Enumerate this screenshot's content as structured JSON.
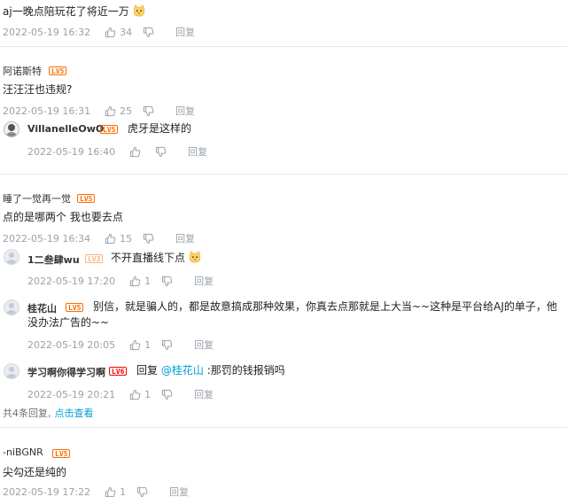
{
  "comments": [
    {
      "text": "aj一晚点陪玩花了将近一万",
      "time": "2022-05-19 16:32",
      "likes": "34",
      "reply_label": "回复"
    },
    {
      "user": "阿诺斯特",
      "level": "LV5",
      "text": "汪汪汪也违规?",
      "time": "2022-05-19 16:31",
      "likes": "25",
      "reply_label": "回复",
      "replies": [
        {
          "user": "VillanelleOwO",
          "level": "LV5",
          "text": "虎牙是这样的",
          "time": "2022-05-19 16:40",
          "reply_label": "回复"
        }
      ]
    },
    {
      "user": "睡了一觉再一觉",
      "level": "LV5",
      "text": "点的是哪两个 我也要去点",
      "time": "2022-05-19 16:34",
      "likes": "15",
      "reply_label": "回复",
      "replies": [
        {
          "user": "1二叁肆wu",
          "level": "LV3",
          "text": "不开直播线下点",
          "time": "2022-05-19 17:20",
          "likes": "1",
          "reply_label": "回复"
        },
        {
          "user": "桂花山",
          "level": "LV5",
          "text": "别信，就是骗人的，都是故意搞成那种效果，你真去点那就是上大当~~这种是平台给AJ的单子，他没办法广告的~~",
          "time": "2022-05-19 20:05",
          "likes": "1",
          "reply_label": "回复"
        },
        {
          "user": "学习啊你得学习啊",
          "level": "LV6",
          "reply_prefix": "回复",
          "mention": "@桂花山",
          "text": ":那罚的钱报销吗",
          "time": "2022-05-19 20:21",
          "likes": "1",
          "reply_label": "回复"
        }
      ],
      "summary_text": "共4条回复,",
      "summary_link": "点击查看"
    },
    {
      "user": "-niBGNR",
      "level": "LV5",
      "text": "尖勾还是纯的",
      "time": "2022-05-19 17:22",
      "likes": "1",
      "reply_label": "回复"
    }
  ],
  "icons": {
    "like": "thumbs-up-icon",
    "dislike": "thumbs-down-icon",
    "emoji": "cat-emoji-icon"
  },
  "colors": {
    "link": "#00a1d6",
    "meta": "#99a2aa",
    "level5": "#ff6c00",
    "level6": "#ff0000"
  }
}
